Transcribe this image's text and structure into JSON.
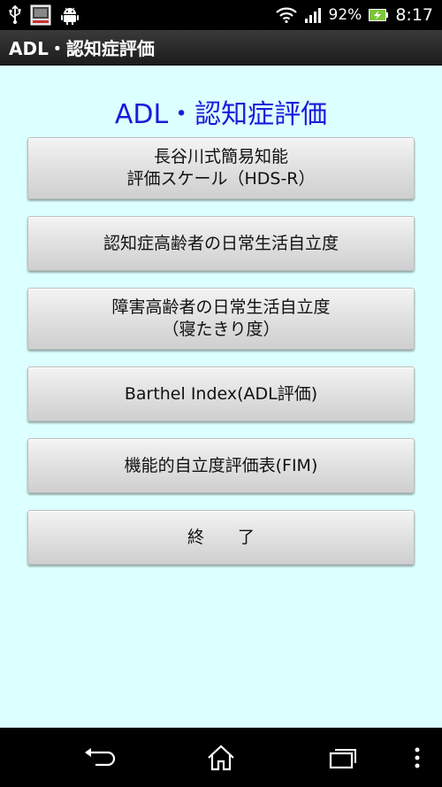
{
  "status_bar": {
    "icons_left": [
      "usb-icon",
      "app-notification-icon",
      "android-debug-icon"
    ],
    "battery_percent": "92%",
    "time": "8:17"
  },
  "title_bar": {
    "title": "ADL・認知症評価"
  },
  "main": {
    "heading": "ADL・認知症評価",
    "buttons": [
      {
        "line1": "長谷川式簡易知能",
        "line2": "評価スケール（HDS-R）"
      },
      {
        "line1": "認知症高齢者の日常生活自立度",
        "line2": ""
      },
      {
        "line1": "障害高齢者の日常生活自立度",
        "line2": "（寝たきり度）"
      },
      {
        "line1": "Barthel Index(ADL評価)",
        "line2": ""
      },
      {
        "line1": "機能的自立度評価表(FIM)",
        "line2": ""
      },
      {
        "line1": "終　　了",
        "line2": ""
      }
    ]
  },
  "nav_bar": {
    "icons": [
      "back-icon",
      "home-icon",
      "recent-apps-icon",
      "menu-icon"
    ]
  },
  "colors": {
    "content_bg": "#dcffff",
    "heading": "#1a1adc",
    "battery_accent": "#7ec63a"
  }
}
